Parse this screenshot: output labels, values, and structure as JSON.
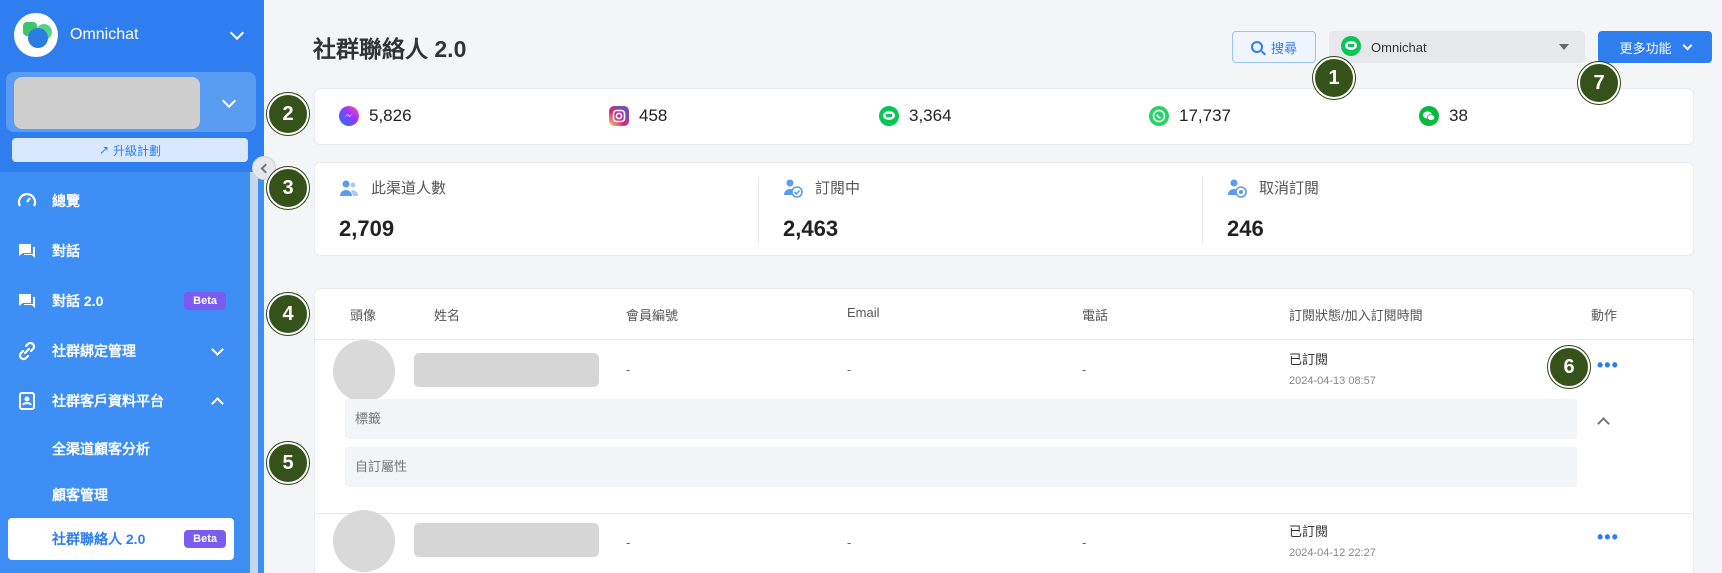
{
  "sidebar": {
    "brand": "Omnichat",
    "upgrade_label": "升級計劃",
    "items": [
      {
        "label": "總覽"
      },
      {
        "label": "對話"
      },
      {
        "label": "對話 2.0",
        "badge": "Beta"
      },
      {
        "label": "社群綁定管理"
      },
      {
        "label": "社群客戶資料平台"
      }
    ],
    "subitems": [
      {
        "label": "全渠道顧客分析"
      },
      {
        "label": "顧客管理"
      },
      {
        "label": "社群聯絡人 2.0",
        "badge": "Beta"
      }
    ]
  },
  "header": {
    "title": "社群聯絡人 2.0",
    "search_label": "搜尋",
    "channel_value": "Omnichat",
    "more_label": "更多功能"
  },
  "channel_stats": [
    {
      "icon": "messenger-icon",
      "value": "5,826"
    },
    {
      "icon": "instagram-icon",
      "value": "458"
    },
    {
      "icon": "line-icon",
      "value": "3,364"
    },
    {
      "icon": "whatsapp-icon",
      "value": "17,737"
    },
    {
      "icon": "wechat-icon",
      "value": "38"
    }
  ],
  "summary": [
    {
      "label": "此渠道人數",
      "value": "2,709"
    },
    {
      "label": "訂閱中",
      "value": "2,463"
    },
    {
      "label": "取消訂閱",
      "value": "246"
    }
  ],
  "table": {
    "headers": [
      "頭像",
      "姓名",
      "會員編號",
      "Email",
      "電話",
      "訂閱狀態/加入訂閱時間",
      "動作"
    ],
    "rows": [
      {
        "member_id": "-",
        "email": "-",
        "phone": "-",
        "status": "已訂閱",
        "time": "2024-04-13 08:57",
        "action": "•••"
      },
      {
        "member_id": "-",
        "email": "-",
        "phone": "-",
        "status": "已訂閱",
        "time": "2024-04-12 22:27",
        "action": "•••"
      }
    ],
    "tag_label": "標籤",
    "custom_attr_label": "自訂屬性"
  },
  "annotations": [
    "1",
    "2",
    "3",
    "4",
    "5",
    "6",
    "7"
  ],
  "colors": {
    "primary": "#2f7ef0",
    "sidebar": "#3d8ef5",
    "beta": "#7b5cf0",
    "annotation": "#36521b",
    "line": "#06c755",
    "whatsapp": "#25d366",
    "wechat": "#09b83e"
  }
}
